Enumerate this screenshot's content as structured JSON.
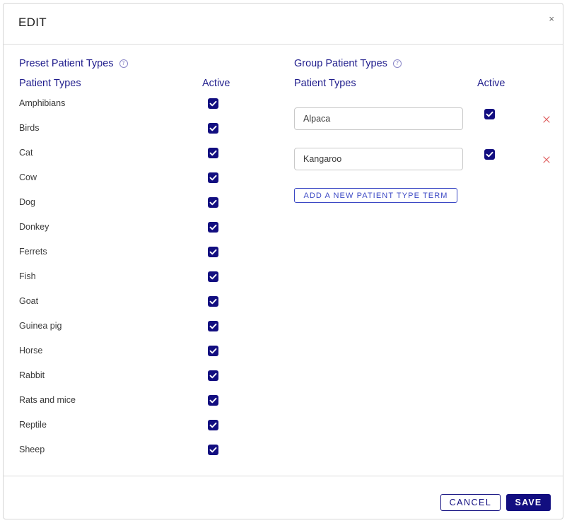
{
  "modal": {
    "title": "EDIT",
    "close_label": "×"
  },
  "preset": {
    "title": "Preset Patient Types",
    "col_types": "Patient Types",
    "col_active": "Active",
    "items": [
      {
        "label": "Amphibians",
        "active": true
      },
      {
        "label": "Birds",
        "active": true
      },
      {
        "label": "Cat",
        "active": true
      },
      {
        "label": "Cow",
        "active": true
      },
      {
        "label": "Dog",
        "active": true
      },
      {
        "label": "Donkey",
        "active": true
      },
      {
        "label": "Ferrets",
        "active": true
      },
      {
        "label": "Fish",
        "active": true
      },
      {
        "label": "Goat",
        "active": true
      },
      {
        "label": "Guinea pig",
        "active": true
      },
      {
        "label": "Horse",
        "active": true
      },
      {
        "label": "Rabbit",
        "active": true
      },
      {
        "label": "Rats and mice",
        "active": true
      },
      {
        "label": "Reptile",
        "active": true
      },
      {
        "label": "Sheep",
        "active": true
      }
    ]
  },
  "group": {
    "title": "Group Patient Types",
    "col_types": "Patient Types",
    "col_active": "Active",
    "items": [
      {
        "value": "Alpaca",
        "active": true
      },
      {
        "value": "Kangaroo",
        "active": true
      }
    ],
    "add_label": "ADD A NEW PATIENT TYPE TERM"
  },
  "footer": {
    "cancel_label": "CANCEL",
    "save_label": "SAVE"
  },
  "colors": {
    "accent": "#120e80",
    "heading": "#1f1c8c",
    "remove": "#e06060",
    "link": "#3b48c4"
  },
  "icons": {
    "help": "help-circle-icon",
    "check": "checkmark-icon",
    "remove": "close-icon"
  }
}
